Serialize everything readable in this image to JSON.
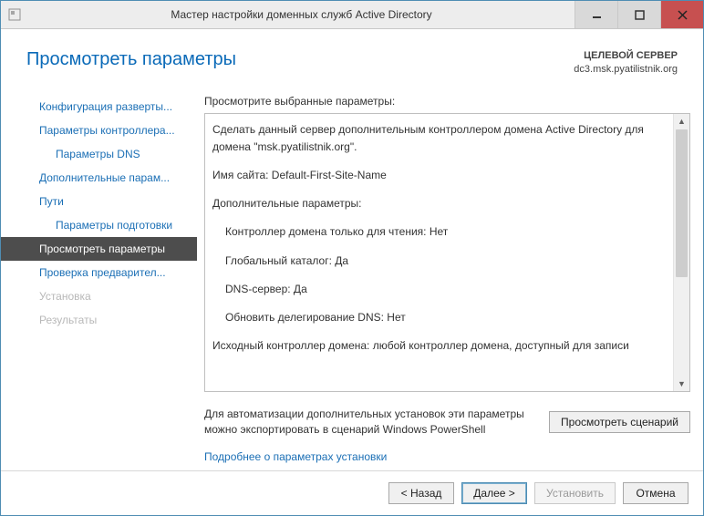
{
  "titlebar": {
    "title": "Мастер настройки доменных служб Active Directory"
  },
  "header": {
    "page_title": "Просмотреть параметры",
    "target_label": "ЦЕЛЕВОЙ СЕРВЕР",
    "target_value": "dc3.msk.pyatilistnik.org"
  },
  "sidebar": {
    "steps": [
      {
        "label": "Конфигурация разверты...",
        "state": "link",
        "indent": false
      },
      {
        "label": "Параметры контроллера...",
        "state": "link",
        "indent": false
      },
      {
        "label": "Параметры DNS",
        "state": "link",
        "indent": true
      },
      {
        "label": "Дополнительные парам...",
        "state": "link",
        "indent": false
      },
      {
        "label": "Пути",
        "state": "link",
        "indent": false
      },
      {
        "label": "Параметры подготовки",
        "state": "link",
        "indent": true
      },
      {
        "label": "Просмотреть параметры",
        "state": "current",
        "indent": false
      },
      {
        "label": "Проверка предварител...",
        "state": "link",
        "indent": false
      },
      {
        "label": "Установка",
        "state": "disabled",
        "indent": false
      },
      {
        "label": "Результаты",
        "state": "disabled",
        "indent": false
      }
    ]
  },
  "review": {
    "instruction": "Просмотрите выбранные параметры:",
    "lines": {
      "l0": "Сделать данный сервер дополнительным контроллером домена Active Directory для домена \"msk.pyatilistnik.org\".",
      "l1": "Имя сайта: Default-First-Site-Name",
      "l2": "Дополнительные параметры:",
      "l3": "Контроллер домена только для чтения: Нет",
      "l4": "Глобальный каталог: Да",
      "l5": "DNS-сервер: Да",
      "l6": "Обновить делегирование DNS: Нет",
      "l7": "Исходный контроллер домена: любой контроллер домена, доступный для записи"
    }
  },
  "export": {
    "text": "Для автоматизации дополнительных установок эти параметры можно экспортировать в сценарий Windows PowerShell",
    "button": "Просмотреть сценарий"
  },
  "more_link": "Подробнее о параметрах установки",
  "footer": {
    "back": "< Назад",
    "next": "Далее >",
    "install": "Установить",
    "cancel": "Отмена"
  }
}
